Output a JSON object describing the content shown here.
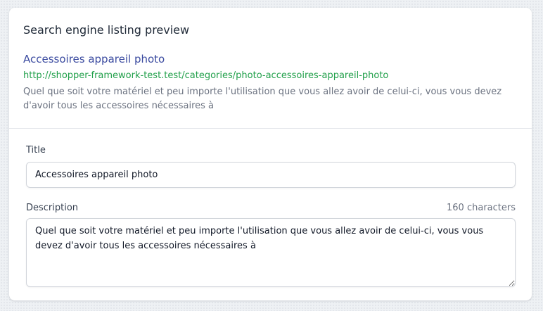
{
  "seo_preview": {
    "heading": "Search engine listing preview",
    "title": "Accessoires appareil photo",
    "url": "http://shopper-framework-test.test/categories/photo-accessoires-appareil-photo",
    "description": "Quel que soit votre matériel et peu importe l'utilisation que vous allez avoir de celui-ci, vous vous devez d'avoir tous les accessoires nécessaires à"
  },
  "form": {
    "title_label": "Title",
    "title_value": "Accessoires appareil photo",
    "description_label": "Description",
    "description_count": "160 characters",
    "description_value": "Quel que soit votre matériel et peu importe l'utilisation que vous allez avoir de celui-ci, vous vous devez d'avoir tous les accessoires nécessaires à"
  },
  "colors": {
    "preview_title": "#3b4ba0",
    "preview_url": "#22a04b",
    "muted_text": "#6b7280",
    "border": "#d1d5db"
  }
}
